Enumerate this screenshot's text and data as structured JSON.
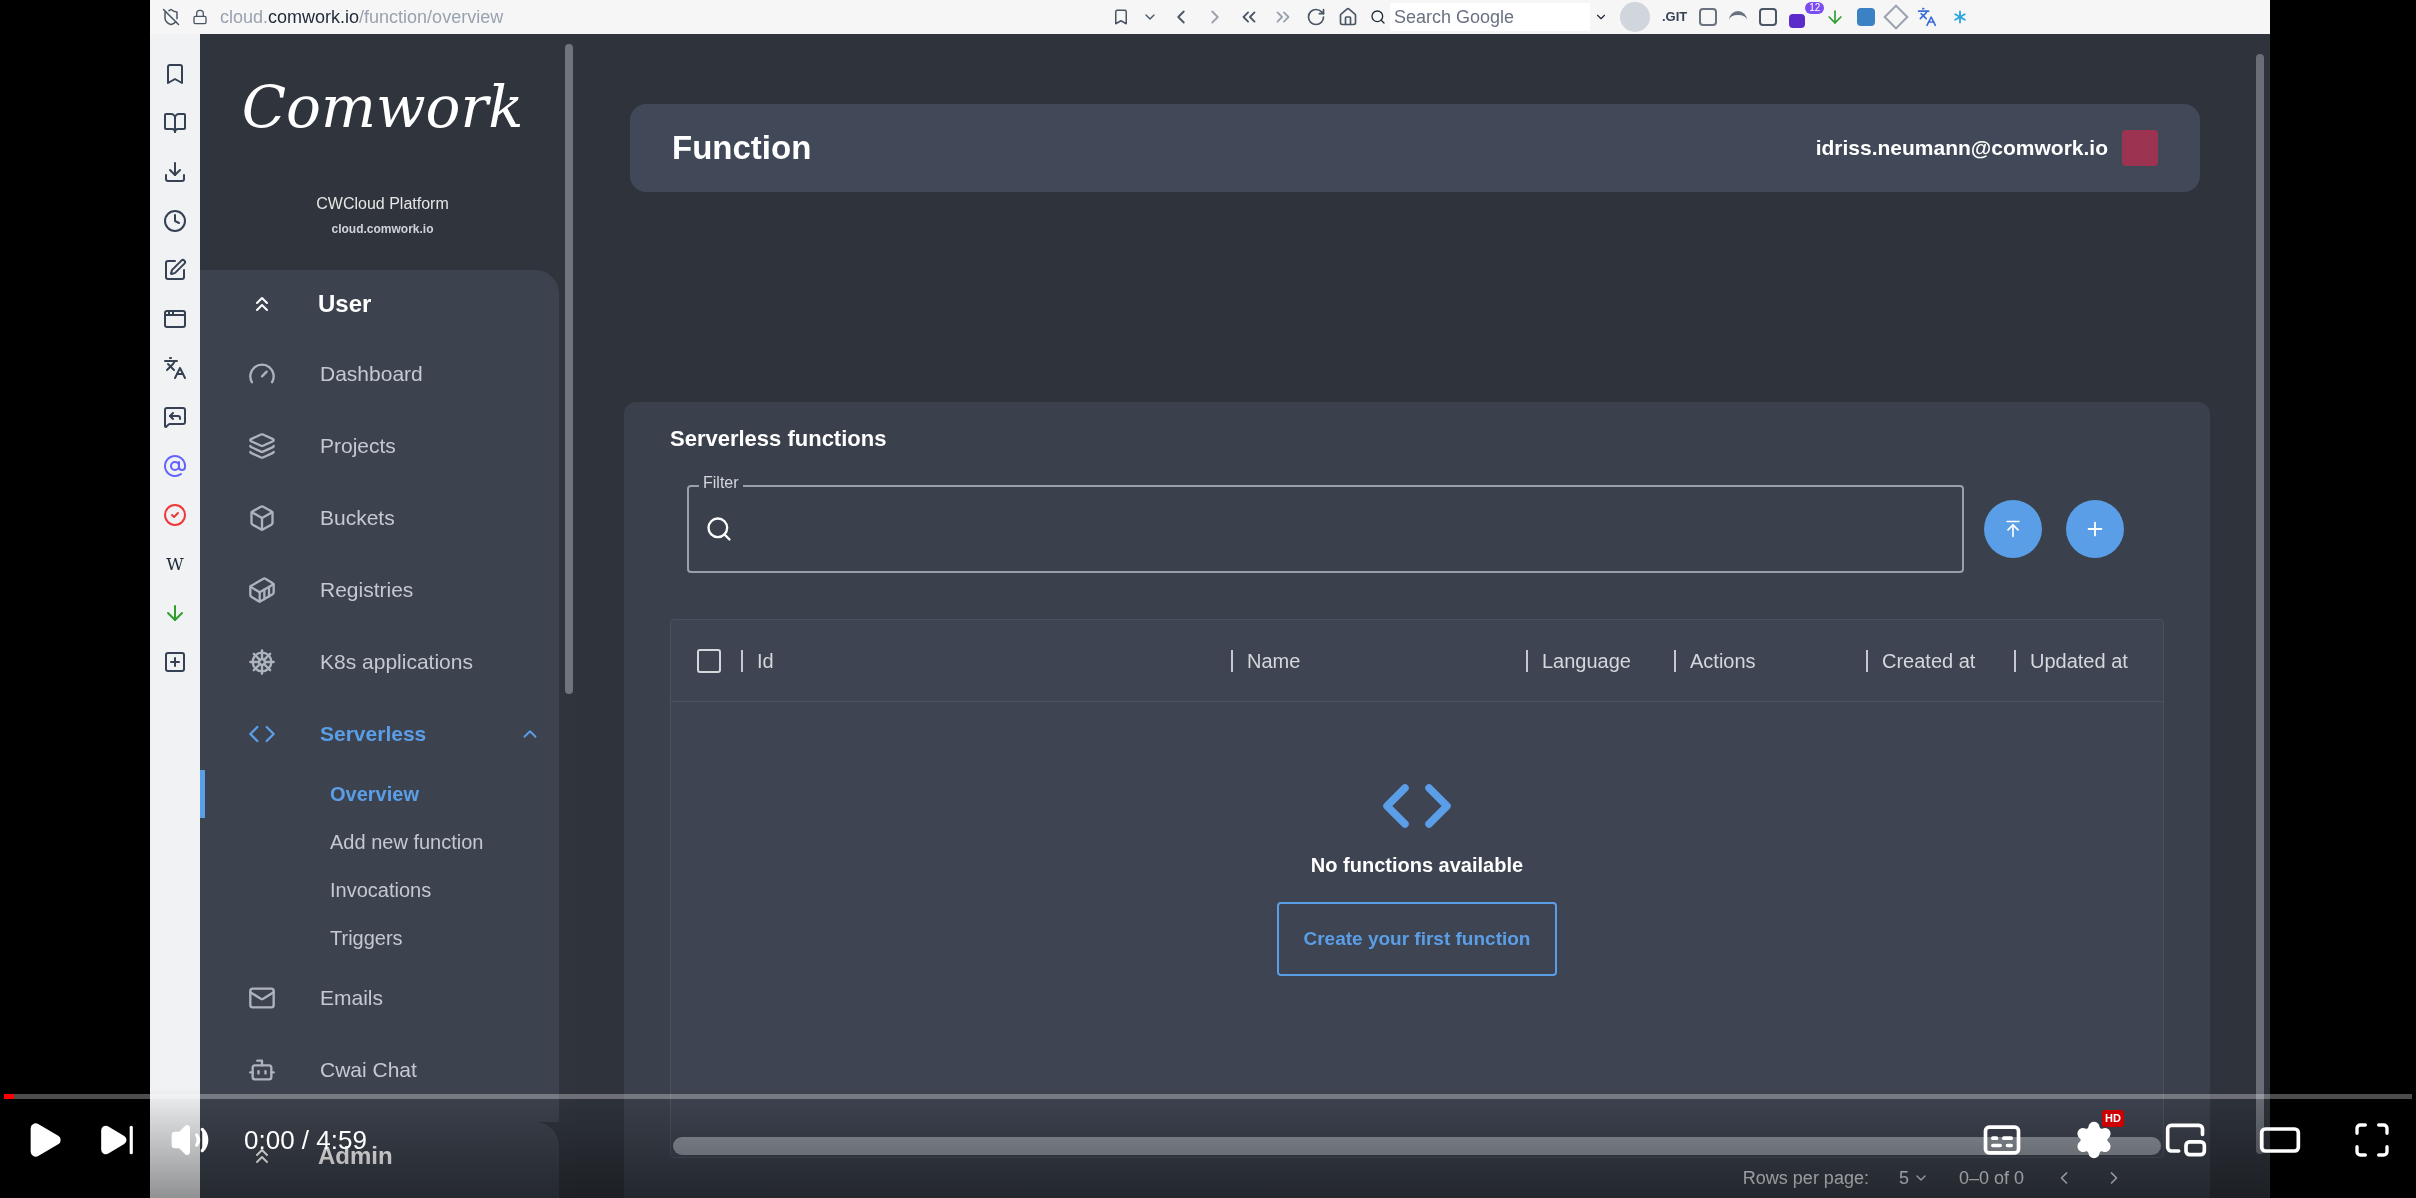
{
  "browser": {
    "url": {
      "prefix": "cloud.",
      "domain": "comwork.io",
      "path": "/function/overview"
    },
    "search_placeholder": "Search Google",
    "extension_label": ".GIT",
    "extension_badge": "12",
    "side_icons": [
      {
        "kind": "bookmark"
      },
      {
        "kind": "reader"
      },
      {
        "kind": "download"
      },
      {
        "kind": "history"
      },
      {
        "kind": "notes"
      },
      {
        "kind": "window"
      },
      {
        "kind": "translate"
      },
      {
        "kind": "chat"
      },
      {
        "kind": "mastodon"
      },
      {
        "kind": "vivaldi"
      },
      {
        "kind": "wikipedia",
        "label": "W"
      },
      {
        "kind": "arrow"
      },
      {
        "kind": "add"
      }
    ]
  },
  "sidebar": {
    "logo": "Comwork",
    "platform": "CWCloud Platform",
    "domain": "cloud.comwork.io",
    "sections": [
      {
        "title": "User",
        "items": [
          {
            "label": "Dashboard",
            "selected": false
          },
          {
            "label": "Projects",
            "selected": false
          },
          {
            "label": "Buckets",
            "selected": false
          },
          {
            "label": "Registries",
            "selected": false
          },
          {
            "label": "K8s applications",
            "selected": false
          },
          {
            "label": "Serverless",
            "selected": true,
            "expanded": true,
            "children": [
              {
                "label": "Overview",
                "selected": true
              },
              {
                "label": "Add new function",
                "selected": false
              },
              {
                "label": "Invocations",
                "selected": false
              },
              {
                "label": "Triggers",
                "selected": false
              }
            ]
          },
          {
            "label": "Emails",
            "selected": false
          },
          {
            "label": "Cwai Chat",
            "selected": false
          }
        ]
      },
      {
        "title": "Admin"
      }
    ]
  },
  "header": {
    "title": "Function",
    "user": "idriss.neumann@comwork.io"
  },
  "card": {
    "title": "Serverless functions",
    "filter": {
      "label": "Filter"
    },
    "table": {
      "columns": [
        "Id",
        "Name",
        "Language",
        "Actions",
        "Created at",
        "Updated at"
      ],
      "select_all_checked": false,
      "empty_text": "No functions available",
      "empty_button": "Create your first function"
    },
    "footer": {
      "rows_label": "Rows per page:",
      "rows_value": "5",
      "range": "0–0 of 0"
    }
  },
  "player": {
    "time": "0:00 / 4:59",
    "level": 0.004,
    "hd_badge": "HD"
  }
}
